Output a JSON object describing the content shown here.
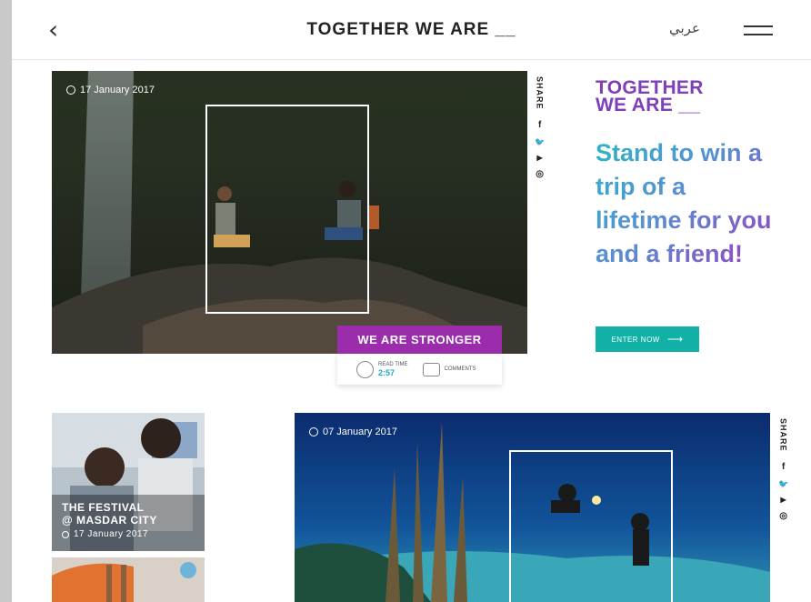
{
  "header": {
    "back_icon": "chevron-left-icon",
    "back_glyph": "‹",
    "title": "TOGETHER WE ARE __",
    "language_label": "عربي",
    "menu_icon": "hamburger-icon"
  },
  "featured_story": {
    "date": "17 January 2017",
    "tag": "WE ARE STRONGER",
    "read_time_label": "READ TIME",
    "read_time_value": "2:57",
    "comments_label": "COMMENTS"
  },
  "share": {
    "label": "SHARE",
    "icons": [
      {
        "name": "facebook-icon",
        "glyph": "f"
      },
      {
        "name": "twitter-icon",
        "glyph": "🐦"
      },
      {
        "name": "youtube-icon",
        "glyph": "▶"
      },
      {
        "name": "instagram-icon",
        "glyph": "◎"
      }
    ]
  },
  "promo": {
    "brand_line1": "TOGETHER",
    "brand_line2": "WE ARE __",
    "headline": "Stand to win a trip of a lifetime for you and a friend!",
    "cta_label": "ENTER NOW",
    "cta_arrow": "⟶",
    "brand_color": "#7e3fb8",
    "cta_color": "#12b1a7"
  },
  "thumb_story": {
    "title_line1": "THE FESTIVAL",
    "title_line2": "@ MASDAR CITY",
    "date": "17 January 2017"
  },
  "dive_story": {
    "date": "07 January 2017"
  },
  "colors": {
    "tag_purple": "#9b2dad",
    "accent_blue": "#1fa8c9"
  }
}
